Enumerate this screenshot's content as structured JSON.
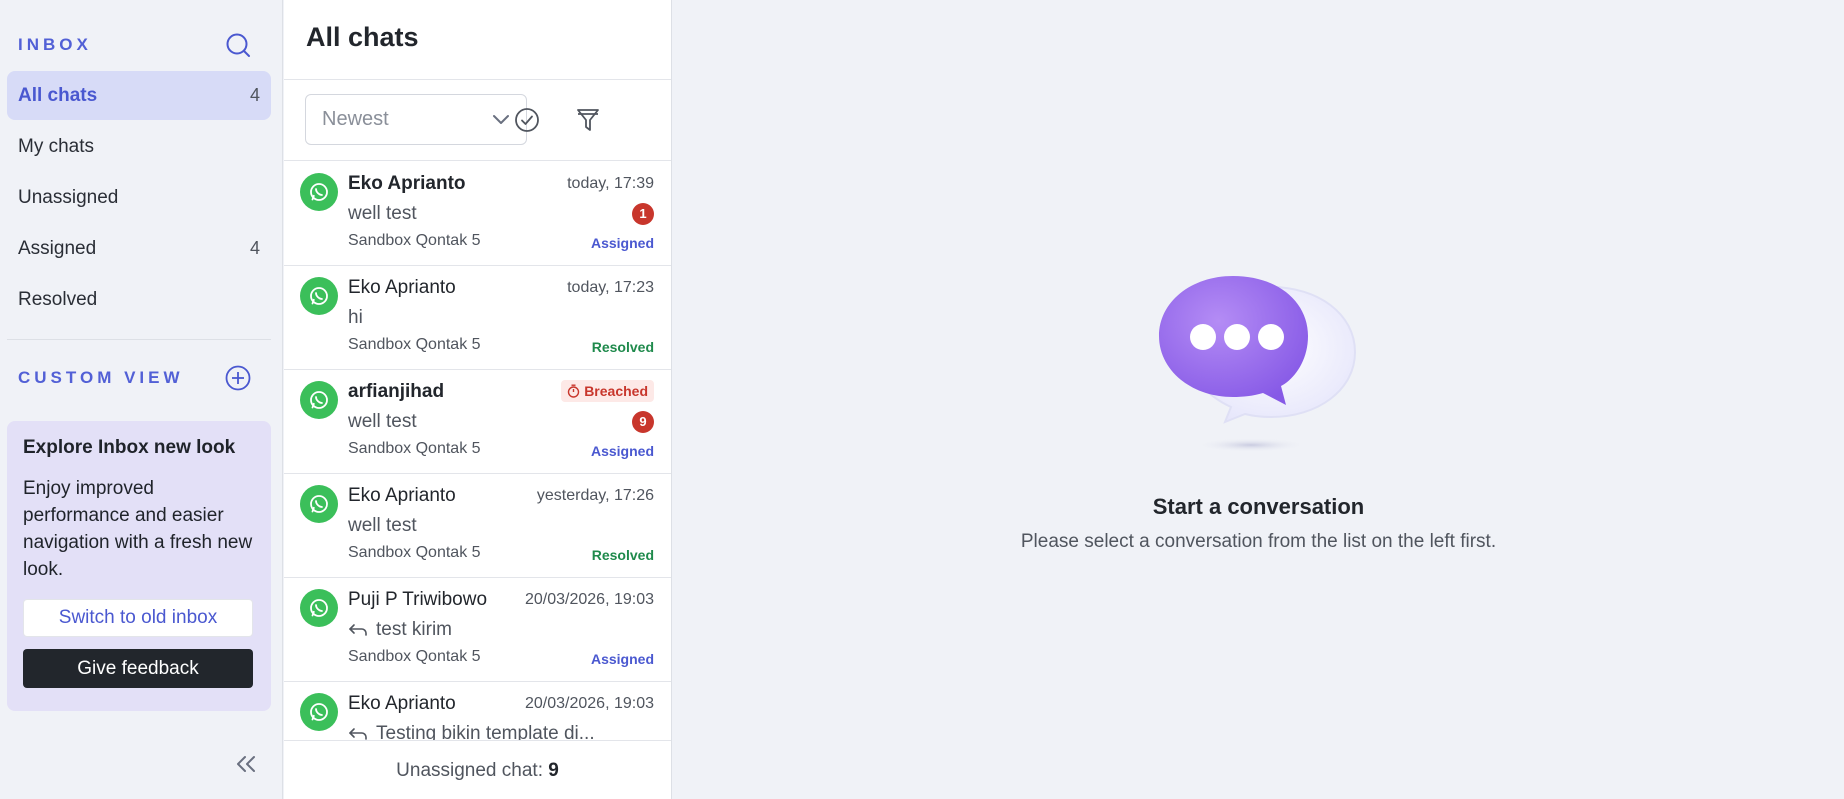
{
  "sidebar": {
    "title": "INBOX",
    "items": [
      {
        "label": "All chats",
        "count": "4",
        "active": true
      },
      {
        "label": "My chats",
        "count": ""
      },
      {
        "label": "Unassigned",
        "count": ""
      },
      {
        "label": "Assigned",
        "count": "4"
      },
      {
        "label": "Resolved",
        "count": ""
      }
    ],
    "custom_view_label": "CUSTOM VIEW",
    "promo": {
      "title": "Explore Inbox new look",
      "text": "Enjoy improved performance and easier navigation with a fresh new look.",
      "switch_label": "Switch to old inbox",
      "feedback_label": "Give feedback"
    }
  },
  "list": {
    "title": "All chats",
    "sort_value": "Newest",
    "chats": [
      {
        "name": "Eko Aprianto",
        "time": "today, 17:39",
        "message": "well test",
        "source": "Sandbox Qontak 5",
        "unread": "1",
        "status": "Assigned",
        "bold": true
      },
      {
        "name": "Eko Aprianto",
        "time": "today, 17:23",
        "message": "hi",
        "source": "Sandbox Qontak 5",
        "status": "Resolved"
      },
      {
        "name": "arfianjihad",
        "breached_label": "Breached",
        "message": "well test",
        "source": "Sandbox Qontak 5",
        "unread": "9",
        "status": "Assigned",
        "bold": true
      },
      {
        "name": "Eko Aprianto",
        "time": "yesterday, 17:26",
        "message": "well test",
        "source": "Sandbox Qontak 5",
        "status": "Resolved"
      },
      {
        "name": "Puji P Triwibowo",
        "time": "20/03/2026, 19:03",
        "message": "test kirim",
        "source": "Sandbox Qontak 5",
        "status": "Assigned",
        "reply": true
      },
      {
        "name": "Eko Aprianto",
        "time": "20/03/2026, 19:03",
        "message": "Testing bikin template di...",
        "source": "",
        "status": "",
        "reply": true
      }
    ],
    "footer_label": "Unassigned chat: ",
    "footer_count": "9"
  },
  "main": {
    "empty_title": "Start a conversation",
    "empty_subtitle": "Please select a conversation from the list on the left first."
  },
  "colors": {
    "accent": "#4a58d0",
    "whatsapp": "#3bbf5a",
    "danger": "#c8362c",
    "resolved": "#1f8a4c"
  }
}
